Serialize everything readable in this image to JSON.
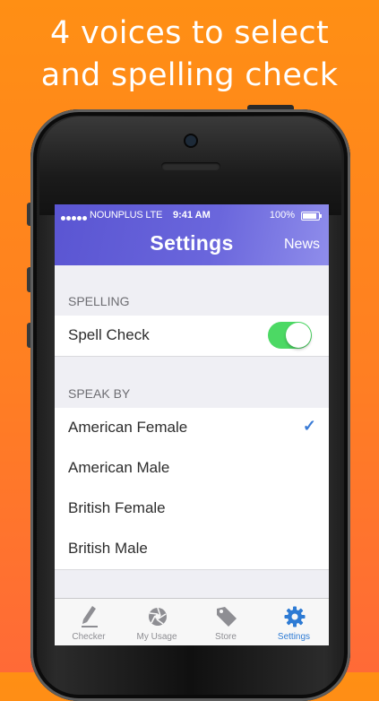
{
  "headline": {
    "line1": "4 voices to select",
    "line2": "and spelling check"
  },
  "status_bar": {
    "carrier": "NOUNPLUS LTE",
    "time": "9:41 AM",
    "battery": "100%"
  },
  "nav": {
    "title": "Settings",
    "right_button": "News"
  },
  "sections": [
    {
      "header": "SPELLING",
      "rows": [
        {
          "label": "Spell Check",
          "toggle_on": true
        }
      ]
    },
    {
      "header": "SPEAK BY",
      "rows": [
        {
          "label": "American Female",
          "checked": true
        },
        {
          "label": "American Male",
          "checked": false
        },
        {
          "label": "British Female",
          "checked": false
        },
        {
          "label": "British Male",
          "checked": false
        }
      ]
    }
  ],
  "tabs": [
    {
      "label": "Checker",
      "icon": "pencil-icon",
      "active": false
    },
    {
      "label": "My Usage",
      "icon": "aperture-icon",
      "active": false
    },
    {
      "label": "Store",
      "icon": "tag-icon",
      "active": false
    },
    {
      "label": "Settings",
      "icon": "gear-icon",
      "active": true
    }
  ],
  "colors": {
    "accent": "#2e7bd4",
    "nav_bar": "#5a55d2",
    "toggle_on": "#4cd964",
    "background": "#ff8c19"
  }
}
